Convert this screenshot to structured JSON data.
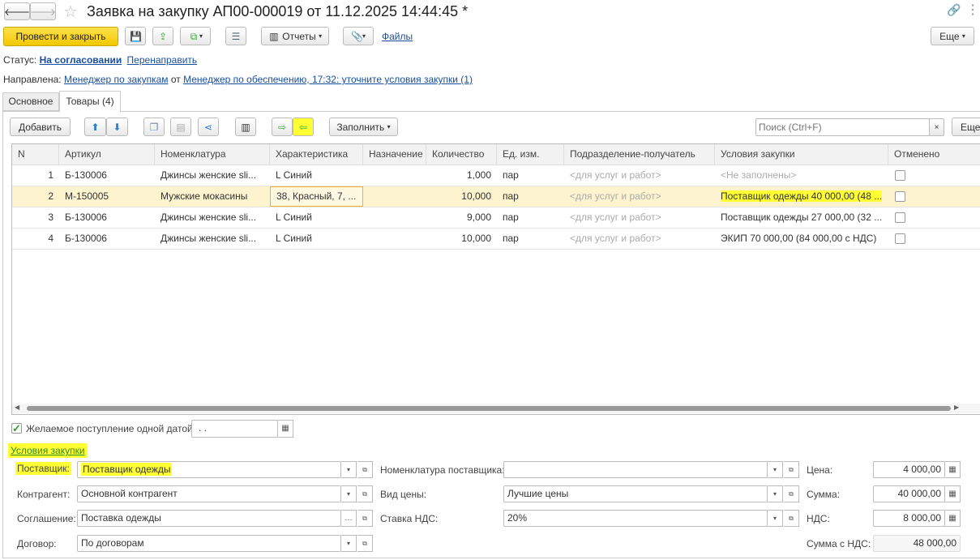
{
  "window": {
    "title": "Заявка на закупку АП00-000019 от 11.12.2025 14:44:45 *"
  },
  "toolbar": {
    "post_close": "Провести и закрыть",
    "reports": "Отчеты",
    "files": "Файлы",
    "more": "Еще"
  },
  "status": {
    "label": "Статус:",
    "value": "На согласовании",
    "redirect": "Перенаправить"
  },
  "sent": {
    "label": "Направлена:",
    "to": "Менеджер по закупкам",
    "from_word": "от",
    "from": "Менеджер по обеспечению, 17:32: уточните условия закупки (1)"
  },
  "tabs": [
    {
      "label": "Основное"
    },
    {
      "label": "Товары (4)"
    }
  ],
  "table_toolbar": {
    "add": "Добавить",
    "fill": "Заполнить",
    "search_placeholder": "Поиск (Ctrl+F)",
    "clear": "×",
    "more": "Еще"
  },
  "table": {
    "columns": [
      "N",
      "Артикул",
      "Номенклатура",
      "Характеристика",
      "Назначение",
      "Количество",
      "Ед. изм.",
      "Подразделение-получатель",
      "Условия закупки",
      "Отменено"
    ],
    "rows": [
      {
        "n": "1",
        "article": "Б-130006",
        "item": "Джинсы женские sli...",
        "char": "L Синий",
        "purpose": "",
        "qty": "1,000",
        "unit": "пар",
        "dept": "<для услуг и работ>",
        "terms": "<Не заполнены>",
        "canceled": false
      },
      {
        "n": "2",
        "article": "М-150005",
        "item": "Мужские мокасины",
        "char": "38, Красный, 7, ...",
        "purpose": "",
        "qty": "10,000",
        "unit": "пар",
        "dept": "<для услуг и работ>",
        "terms": "Поставщик одежды 40 000,00 (48 ...",
        "canceled": false
      },
      {
        "n": "3",
        "article": "Б-130006",
        "item": "Джинсы женские sli...",
        "char": "L Синий",
        "purpose": "",
        "qty": "9,000",
        "unit": "пар",
        "dept": "<для услуг и работ>",
        "terms": "Поставщик одежды 27 000,00 (32 ...",
        "canceled": false
      },
      {
        "n": "4",
        "article": "Б-130006",
        "item": "Джинсы женские sli...",
        "char": "L Синий",
        "purpose": "",
        "qty": "10,000",
        "unit": "пар",
        "dept": "<для услуг и работ>",
        "terms": "ЭКИП 70 000,00 (84 000,00 с НДС)",
        "canceled": false
      }
    ]
  },
  "desired": {
    "label": "Желаемое поступление одной датой",
    "checked": true,
    "date": " .  ."
  },
  "terms": {
    "title": "Условия закупки",
    "supplier_label": "Поставщик:",
    "supplier": "Поставщик одежды",
    "counterparty_label": "Контрагент:",
    "counterparty": "Основной контрагент",
    "agreement_label": "Соглашение:",
    "agreement": "Поставка одежды",
    "contract_label": "Договор:",
    "contract": "По договорам",
    "supplier_item_label": "Номенклатура поставщика:",
    "supplier_item": "",
    "price_type_label": "Вид цены:",
    "price_type": "Лучшие цены",
    "vat_rate_label": "Ставка НДС:",
    "vat_rate": "20%",
    "price_label": "Цена:",
    "price": "4 000,00",
    "sum_label": "Сумма:",
    "sum": "40 000,00",
    "vat_label": "НДС:",
    "vat": "8 000,00",
    "total_label": "Сумма с НДС:",
    "total": "48 000,00"
  },
  "colors": {
    "primary_button": "#f5d327",
    "highlight": "#ffff33",
    "selected_row": "#fdf4cf",
    "link": "#1a4fa0"
  }
}
